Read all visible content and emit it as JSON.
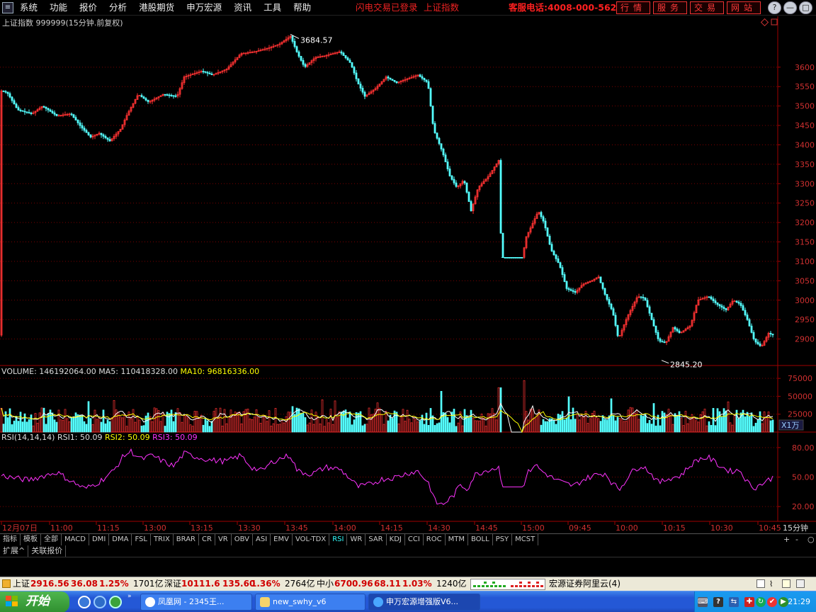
{
  "menubar": {
    "items": [
      "系统",
      "功能",
      "报价",
      "分析",
      "港股期货",
      "申万宏源",
      "资讯",
      "工具",
      "帮助"
    ],
    "status_login": "闪电交易已登录",
    "status_index": "上证指数",
    "hotline": "客服电话:4008-000-562",
    "buttons": [
      "行情",
      "服务",
      "交易",
      "网站"
    ],
    "window_buttons": [
      "?",
      "—",
      "□",
      "✕"
    ]
  },
  "chart_data": {
    "type": "candlestick",
    "title": "上证指数 999999(15分钟.前复权)",
    "price_axis": {
      "ticks": [
        2900,
        2950,
        3000,
        3050,
        3100,
        3150,
        3200,
        3250,
        3300,
        3350,
        3400,
        3450,
        3500,
        3550,
        3600
      ],
      "range": [
        2830,
        3700
      ]
    },
    "high_label": "3684.57",
    "low_label": "2845.20",
    "time_labels": [
      "12月07日",
      "11:00",
      "11:15",
      "13:00",
      "13:15",
      "13:30",
      "13:45",
      "14:00",
      "14:15",
      "14:30",
      "14:45",
      "15:00",
      "09:45",
      "10:00",
      "10:15",
      "10:30",
      "10:45"
    ],
    "period": "15分钟",
    "price_keypoints": [
      [
        0,
        3540
      ],
      [
        10,
        3535
      ],
      [
        25,
        3490
      ],
      [
        45,
        3480
      ],
      [
        60,
        3500
      ],
      [
        80,
        3475
      ],
      [
        100,
        3480
      ],
      [
        115,
        3445
      ],
      [
        128,
        3420
      ],
      [
        140,
        3430
      ],
      [
        155,
        3410
      ],
      [
        170,
        3440
      ],
      [
        180,
        3480
      ],
      [
        195,
        3530
      ],
      [
        210,
        3510
      ],
      [
        230,
        3530
      ],
      [
        250,
        3525
      ],
      [
        260,
        3575
      ],
      [
        285,
        3590
      ],
      [
        300,
        3580
      ],
      [
        320,
        3595
      ],
      [
        340,
        3635
      ],
      [
        360,
        3640
      ],
      [
        380,
        3650
      ],
      [
        395,
        3660
      ],
      [
        410,
        3680
      ],
      [
        420,
        3635
      ],
      [
        430,
        3600
      ],
      [
        445,
        3625
      ],
      [
        460,
        3630
      ],
      [
        480,
        3640
      ],
      [
        495,
        3610
      ],
      [
        505,
        3560
      ],
      [
        515,
        3525
      ],
      [
        530,
        3545
      ],
      [
        545,
        3575
      ],
      [
        560,
        3560
      ],
      [
        575,
        3570
      ],
      [
        590,
        3580
      ],
      [
        604,
        3560
      ],
      [
        612,
        3440
      ],
      [
        625,
        3380
      ],
      [
        635,
        3320
      ],
      [
        645,
        3290
      ],
      [
        655,
        3310
      ],
      [
        665,
        3230
      ],
      [
        675,
        3290
      ],
      [
        690,
        3320
      ],
      [
        704,
        3360
      ],
      [
        708,
        3110
      ],
      [
        738,
        3110
      ],
      [
        742,
        3160
      ],
      [
        750,
        3190
      ],
      [
        760,
        3230
      ],
      [
        768,
        3200
      ],
      [
        778,
        3130
      ],
      [
        790,
        3090
      ],
      [
        800,
        3030
      ],
      [
        812,
        3020
      ],
      [
        822,
        3040
      ],
      [
        835,
        3050
      ],
      [
        845,
        3060
      ],
      [
        855,
        3010
      ],
      [
        865,
        2970
      ],
      [
        873,
        2900
      ],
      [
        885,
        2955
      ],
      [
        900,
        3010
      ],
      [
        910,
        3005
      ],
      [
        920,
        2950
      ],
      [
        930,
        2895
      ],
      [
        940,
        2890
      ],
      [
        950,
        2930
      ],
      [
        960,
        2915
      ],
      [
        975,
        2935
      ],
      [
        985,
        3000
      ],
      [
        1000,
        3010
      ],
      [
        1012,
        2990
      ],
      [
        1025,
        2975
      ],
      [
        1035,
        3000
      ],
      [
        1045,
        2990
      ],
      [
        1055,
        2950
      ],
      [
        1065,
        2895
      ],
      [
        1075,
        2880
      ],
      [
        1085,
        2915
      ],
      [
        1092,
        2910
      ]
    ],
    "volume": {
      "label": "VOLUME: 146192064.00",
      "ma5_label": "MA5: 110418328.00",
      "ma10_label": "MA10: 96816336.00",
      "ticks": [
        25000,
        50000,
        75000
      ],
      "unit": "X1万"
    },
    "rsi": {
      "label": "RSI(14,14,14)",
      "rsi1_label": "RSI1: 50.09",
      "rsi2_label": "RSI2: 50.09",
      "rsi3_label": "RSI3: 50.09",
      "ticks": [
        "20.00",
        "50.00",
        "80.00"
      ],
      "keypoints": [
        [
          0,
          52
        ],
        [
          20,
          49
        ],
        [
          40,
          47
        ],
        [
          60,
          51
        ],
        [
          80,
          55
        ],
        [
          100,
          46
        ],
        [
          120,
          38
        ],
        [
          140,
          45
        ],
        [
          160,
          56
        ],
        [
          175,
          72
        ],
        [
          185,
          76
        ],
        [
          200,
          68
        ],
        [
          215,
          72
        ],
        [
          230,
          66
        ],
        [
          245,
          61
        ],
        [
          260,
          74
        ],
        [
          280,
          70
        ],
        [
          300,
          67
        ],
        [
          320,
          66
        ],
        [
          340,
          72
        ],
        [
          355,
          60
        ],
        [
          370,
          56
        ],
        [
          385,
          66
        ],
        [
          400,
          70
        ],
        [
          410,
          72
        ],
        [
          420,
          56
        ],
        [
          440,
          53
        ],
        [
          460,
          60
        ],
        [
          480,
          58
        ],
        [
          495,
          48
        ],
        [
          505,
          40
        ],
        [
          520,
          42
        ],
        [
          540,
          48
        ],
        [
          560,
          50
        ],
        [
          575,
          54
        ],
        [
          590,
          56
        ],
        [
          605,
          44
        ],
        [
          615,
          24
        ],
        [
          625,
          22
        ],
        [
          640,
          31
        ],
        [
          650,
          42
        ],
        [
          660,
          38
        ],
        [
          670,
          52
        ],
        [
          690,
          58
        ],
        [
          706,
          60
        ],
        [
          708,
          40
        ],
        [
          738,
          40
        ],
        [
          745,
          54
        ],
        [
          755,
          63
        ],
        [
          765,
          56
        ],
        [
          780,
          49
        ],
        [
          795,
          44
        ],
        [
          810,
          41
        ],
        [
          825,
          48
        ],
        [
          840,
          52
        ],
        [
          855,
          54
        ],
        [
          865,
          43
        ],
        [
          875,
          38
        ],
        [
          890,
          54
        ],
        [
          905,
          62
        ],
        [
          915,
          57
        ],
        [
          930,
          44
        ],
        [
          945,
          49
        ],
        [
          960,
          51
        ],
        [
          975,
          62
        ],
        [
          985,
          68
        ],
        [
          1000,
          70
        ],
        [
          1015,
          62
        ],
        [
          1030,
          56
        ],
        [
          1045,
          57
        ],
        [
          1055,
          45
        ],
        [
          1065,
          39
        ],
        [
          1080,
          45
        ],
        [
          1092,
          50
        ]
      ]
    }
  },
  "tabs": {
    "items": [
      "指标",
      "模板",
      "全部",
      "MACD",
      "DMI",
      "DMA",
      "FSL",
      "TRIX",
      "BRAR",
      "CR",
      "VR",
      "OBV",
      "ASI",
      "EMV",
      "VOL-TDX",
      "RSI",
      "WR",
      "SAR",
      "KDJ",
      "CCI",
      "ROC",
      "MTM",
      "BOLL",
      "PSY",
      "MCST"
    ],
    "active": "RSI",
    "controls": [
      "+",
      "-",
      "○"
    ]
  },
  "ext_tabs": [
    "扩展^",
    "关联报价"
  ],
  "status": {
    "sh_name": "上证",
    "sh_value": "2916.56",
    "sh_change": "36.08",
    "sh_pct": "1.25%",
    "sh_amount": "1701亿",
    "sz_name": "深证",
    "sz_value": "10111.6",
    "sz_change": "135.60",
    "sz_pct": "1.36%",
    "sz_amount": "2764亿",
    "zx_name": "中小",
    "zx_value": "6700.96",
    "zx_change": "68.11",
    "zx_pct": "1.03%",
    "zx_amount": "1240亿",
    "server": "宏源证券阿里云(4)"
  },
  "taskbar": {
    "start": "开始",
    "tasks": [
      "凤凰网 - 2345王...",
      "new_swhy_v6",
      "申万宏源增强版V6..."
    ],
    "clock": "21:29"
  },
  "colors": {
    "up": "#ff3232",
    "down": "#54ffff",
    "ma5": "#ffffff",
    "ma10": "#ffff00",
    "rsi": "#ff33ff",
    "axis": "#a00000",
    "grid": "#7a0000"
  }
}
